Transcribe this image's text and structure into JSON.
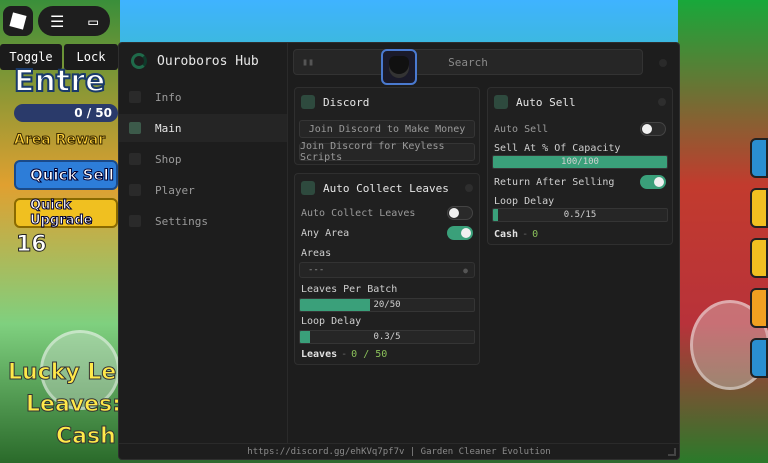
{
  "game": {
    "toggle_label": "Toggle",
    "lock_label": "Lock",
    "entrance_text": "Entre",
    "capacity_text": "0 / 50",
    "area_reward_text": "Area Rewar",
    "quick_sell_label": "Quick Sell",
    "quick_upgrade_label": "Quick Upgrade",
    "count_text": "16",
    "lucky_text": "Lucky Le",
    "leaves_text": "Leaves:",
    "cash_text": "Cash"
  },
  "hub": {
    "title": "Ouroboros Hub",
    "search_placeholder": "Search",
    "footer": "https://discord.gg/ehKVq7pf7v | Garden Cleaner Evolution",
    "nav": [
      {
        "label": "Info",
        "active": false
      },
      {
        "label": "Main",
        "active": true
      },
      {
        "label": "Shop",
        "active": false
      },
      {
        "label": "Player",
        "active": false
      },
      {
        "label": "Settings",
        "active": false
      }
    ]
  },
  "discord": {
    "title": "Discord",
    "join_money": "Join Discord to Make Money",
    "join_keyless": "Join Discord for Keyless Scripts"
  },
  "auto_collect": {
    "title": "Auto Collect Leaves",
    "toggle_label": "Auto Collect Leaves",
    "toggle_on": false,
    "any_area_label": "Any Area",
    "any_area_on": true,
    "areas_label": "Areas",
    "areas_value": "---",
    "batch_label": "Leaves Per Batch",
    "batch_value": "20/50",
    "batch_fraction": 0.4,
    "delay_label": "Loop Delay",
    "delay_value": "0.3/5",
    "delay_fraction": 0.06,
    "leaves_stat_label": "Leaves",
    "leaves_stat_sep": "-",
    "leaves_stat_value": "0 / 50"
  },
  "auto_sell": {
    "title": "Auto Sell",
    "toggle_label": "Auto Sell",
    "toggle_on": false,
    "capacity_label": "Sell At % Of Capacity",
    "capacity_value": "100/100",
    "capacity_fraction": 1.0,
    "return_label": "Return After Selling",
    "return_on": true,
    "delay_label": "Loop Delay",
    "delay_value": "0.5/15",
    "delay_fraction": 0.03,
    "cash_stat_label": "Cash",
    "cash_stat_sep": "-",
    "cash_stat_value": "0"
  },
  "colors": {
    "accent": "#3aa07a",
    "panel": "#1d1d1d",
    "avatar_border": "#4a7ad0"
  }
}
